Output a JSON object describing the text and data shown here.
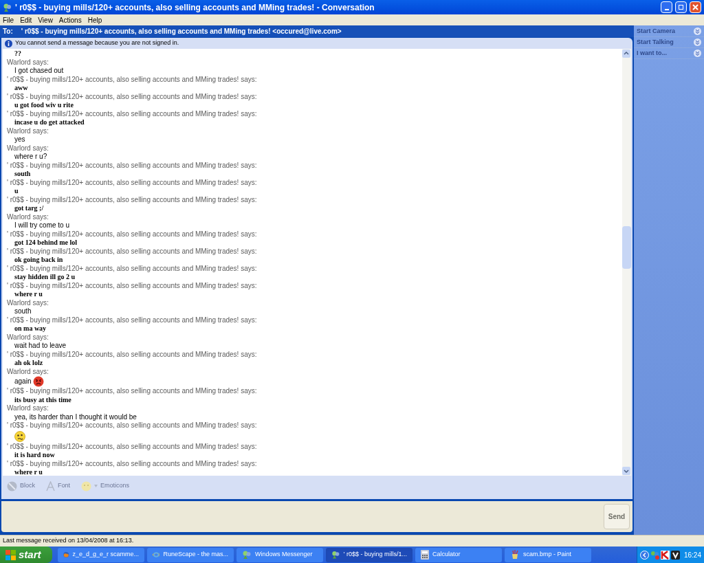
{
  "window": {
    "title": "' r0$$ - buying mills/120+ accounts, also selling accounts and MMing trades! - Conversation"
  },
  "menu": [
    "File",
    "Edit",
    "View",
    "Actions",
    "Help"
  ],
  "to_bar": {
    "label": "To:",
    "recipient": "' r0$$ - buying mills/120+ accounts, also selling accounts and MMing trades! <occured@live.com>"
  },
  "notice": "You cannot send a message because you are not signed in.",
  "conversation": [
    {
      "kind": "message",
      "text": "??",
      "bold": true
    },
    {
      "kind": "sender",
      "text": "Warlord says:"
    },
    {
      "kind": "message",
      "text": "I got chased out",
      "bold": false
    },
    {
      "kind": "sender",
      "text": "' r0$$ - buying mills/120+ accounts, also selling accounts and MMing trades! says:"
    },
    {
      "kind": "message",
      "text": "aww",
      "bold": true
    },
    {
      "kind": "sender",
      "text": "' r0$$ - buying mills/120+ accounts, also selling accounts and MMing trades! says:"
    },
    {
      "kind": "message",
      "text": "u got food wiv u rite",
      "bold": true
    },
    {
      "kind": "sender",
      "text": "' r0$$ - buying mills/120+ accounts, also selling accounts and MMing trades! says:"
    },
    {
      "kind": "message",
      "text": "incase u do get attacked",
      "bold": true
    },
    {
      "kind": "sender",
      "text": "Warlord says:"
    },
    {
      "kind": "message",
      "text": "yes",
      "bold": false
    },
    {
      "kind": "sender",
      "text": "Warlord says:"
    },
    {
      "kind": "message",
      "text": "where r u?",
      "bold": false
    },
    {
      "kind": "sender",
      "text": "' r0$$ - buying mills/120+ accounts, also selling accounts and MMing trades! says:"
    },
    {
      "kind": "message",
      "text": "south",
      "bold": true
    },
    {
      "kind": "sender",
      "text": "' r0$$ - buying mills/120+ accounts, also selling accounts and MMing trades! says:"
    },
    {
      "kind": "message",
      "text": "u",
      "bold": true
    },
    {
      "kind": "sender",
      "text": "' r0$$ - buying mills/120+ accounts, also selling accounts and MMing trades! says:"
    },
    {
      "kind": "message",
      "text": "got targ ;/",
      "bold": true
    },
    {
      "kind": "sender",
      "text": "Warlord says:"
    },
    {
      "kind": "message",
      "text": "I will try come to u",
      "bold": false
    },
    {
      "kind": "sender",
      "text": "' r0$$ - buying mills/120+ accounts, also selling accounts and MMing trades! says:"
    },
    {
      "kind": "message",
      "text": "got 124 behind me lol",
      "bold": true
    },
    {
      "kind": "sender",
      "text": "' r0$$ - buying mills/120+ accounts, also selling accounts and MMing trades! says:"
    },
    {
      "kind": "message",
      "text": "ok going back in",
      "bold": true
    },
    {
      "kind": "sender",
      "text": "' r0$$ - buying mills/120+ accounts, also selling accounts and MMing trades! says:"
    },
    {
      "kind": "message",
      "text": "stay hidden ill go 2 u",
      "bold": true
    },
    {
      "kind": "sender",
      "text": "' r0$$ - buying mills/120+ accounts, also selling accounts and MMing trades! says:"
    },
    {
      "kind": "message",
      "text": "where r u",
      "bold": true
    },
    {
      "kind": "sender",
      "text": "Warlord says:"
    },
    {
      "kind": "message",
      "text": "south",
      "bold": false
    },
    {
      "kind": "sender",
      "text": "' r0$$ - buying mills/120+ accounts, also selling accounts and MMing trades! says:"
    },
    {
      "kind": "message",
      "text": "on ma way",
      "bold": true
    },
    {
      "kind": "sender",
      "text": "Warlord says:"
    },
    {
      "kind": "message",
      "text": "wait had to leave",
      "bold": false
    },
    {
      "kind": "sender",
      "text": "' r0$$ - buying mills/120+ accounts, also selling accounts and MMing trades! says:"
    },
    {
      "kind": "message",
      "text": "ah ok lolz",
      "bold": true
    },
    {
      "kind": "sender",
      "text": "Warlord says:"
    },
    {
      "kind": "message",
      "text": "again",
      "bold": false,
      "emoticon": {
        "kind": "angry"
      }
    },
    {
      "kind": "sender",
      "text": "' r0$$ - buying mills/120+ accounts, also selling accounts and MMing trades! says:"
    },
    {
      "kind": "message",
      "text": "its busy at this time",
      "bold": true
    },
    {
      "kind": "sender",
      "text": "Warlord says:"
    },
    {
      "kind": "message",
      "text": "yea, its harder than I thought it would be",
      "bold": false
    },
    {
      "kind": "sender",
      "text": "' r0$$ - buying mills/120+ accounts, also selling accounts and MMing trades! says:"
    },
    {
      "kind": "emoticon",
      "emoticon": {
        "kind": "confused"
      }
    },
    {
      "kind": "sender",
      "text": "' r0$$ - buying mills/120+ accounts, also selling accounts and MMing trades! says:"
    },
    {
      "kind": "message",
      "text": "it is hard now",
      "bold": true
    },
    {
      "kind": "sender",
      "text": "' r0$$ - buying mills/120+ accounts, also selling accounts and MMing trades! says:"
    },
    {
      "kind": "message",
      "text": "where r u",
      "bold": true
    }
  ],
  "toolbar": [
    {
      "kind": "block",
      "label": "Block",
      "disabled": true
    },
    {
      "kind": "font",
      "label": "Font",
      "disabled": true
    },
    {
      "kind": "emoticons",
      "label": "Emoticons",
      "disabled": true
    }
  ],
  "send_button": {
    "label": "Send",
    "disabled": true
  },
  "side_panel": [
    {
      "label": "Start Camera",
      "disabled": true
    },
    {
      "label": "Start Talking",
      "disabled": true
    },
    {
      "label": "I want to...",
      "disabled": true
    }
  ],
  "status_bar": "Last message received on 13/04/2008 at 16:13.",
  "taskbar": {
    "start": "start",
    "items": [
      {
        "kind": "firefox",
        "label": "z_e_d_g_e_r scamme...",
        "selected": false
      },
      {
        "kind": "ie",
        "label": "RuneScape - the mas...",
        "selected": false
      },
      {
        "kind": "messenger",
        "label": "Windows Messenger",
        "selected": false
      },
      {
        "kind": "messenger",
        "label": "' r0$$ - buying mills/1...",
        "selected": true
      },
      {
        "kind": "calculator",
        "label": "Calculator",
        "selected": false
      },
      {
        "kind": "paint",
        "label": "scam.bmp - Paint",
        "selected": false
      }
    ],
    "clock": "16:24"
  }
}
